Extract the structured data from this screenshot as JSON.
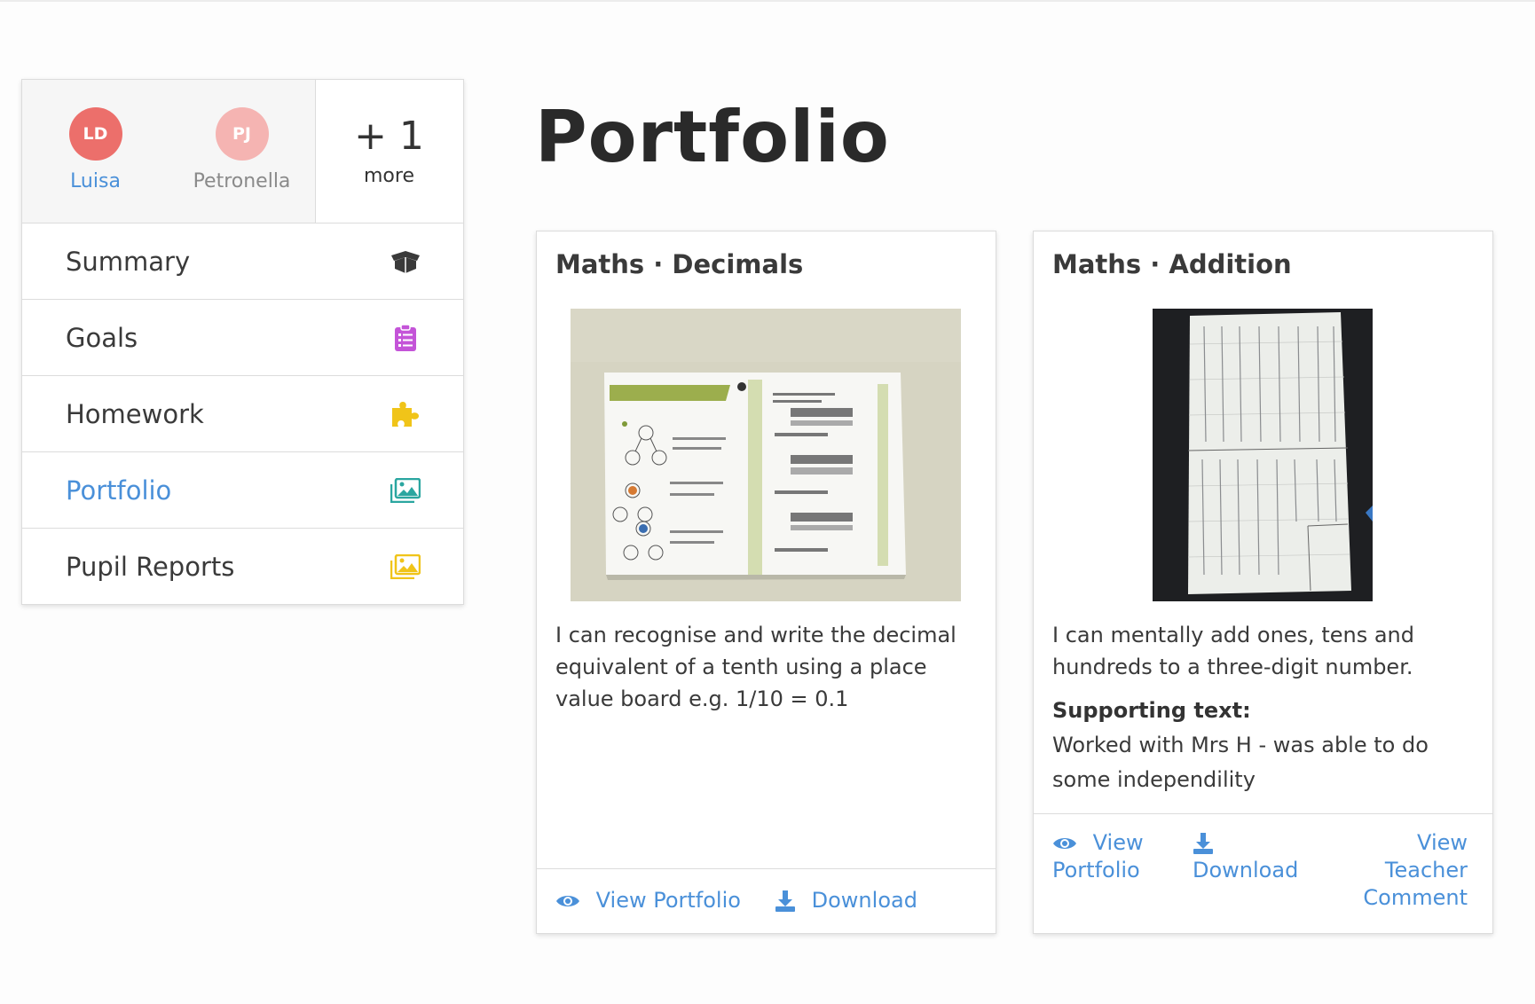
{
  "pupils": [
    {
      "initials": "LD",
      "name": "Luisa",
      "color": "#ec6f6b",
      "selected": true
    },
    {
      "initials": "PJ",
      "name": "Petronella",
      "color": "#f5b4b2",
      "selected": false
    }
  ],
  "more": {
    "count": "+ 1",
    "label": "more"
  },
  "nav": {
    "items": [
      {
        "label": "Summary",
        "icon": "box-icon",
        "color": "#3a3a3a"
      },
      {
        "label": "Goals",
        "icon": "clipboard-list-icon",
        "color": "#c454d8"
      },
      {
        "label": "Homework",
        "icon": "puzzle-icon",
        "color": "#f0c419"
      },
      {
        "label": "Portfolio",
        "icon": "images-icon",
        "color": "#2aa6a0",
        "active": true
      },
      {
        "label": "Pupil Reports",
        "icon": "images-icon",
        "color": "#f0c419"
      }
    ]
  },
  "page": {
    "title": "Portfolio"
  },
  "cards": [
    {
      "title": "Maths · Decimals",
      "image": "worksheet-photo",
      "text": "I can recognise and write the decimal equivalent of a tenth using a place value board e.g. 1/10 = 0.1",
      "actions": {
        "view": "View Portfolio",
        "download": "Download"
      }
    },
    {
      "title": "Maths · Addition",
      "image": "handwritten-sheet-photo",
      "text": "I can mentally add ones, tens and hundreds to a three-digit number.",
      "supporting_heading": "Supporting text:",
      "supporting_text": "Worked with Mrs H - was able to do some independility",
      "actions": {
        "view_line1": "View",
        "view_line2": "Portfolio",
        "download": "Download",
        "comment_line1": "View",
        "comment_line2": "Teacher",
        "comment_line3": "Comment"
      }
    }
  ],
  "colors": {
    "accent": "#4a90d9",
    "border": "#dcdcdc"
  }
}
